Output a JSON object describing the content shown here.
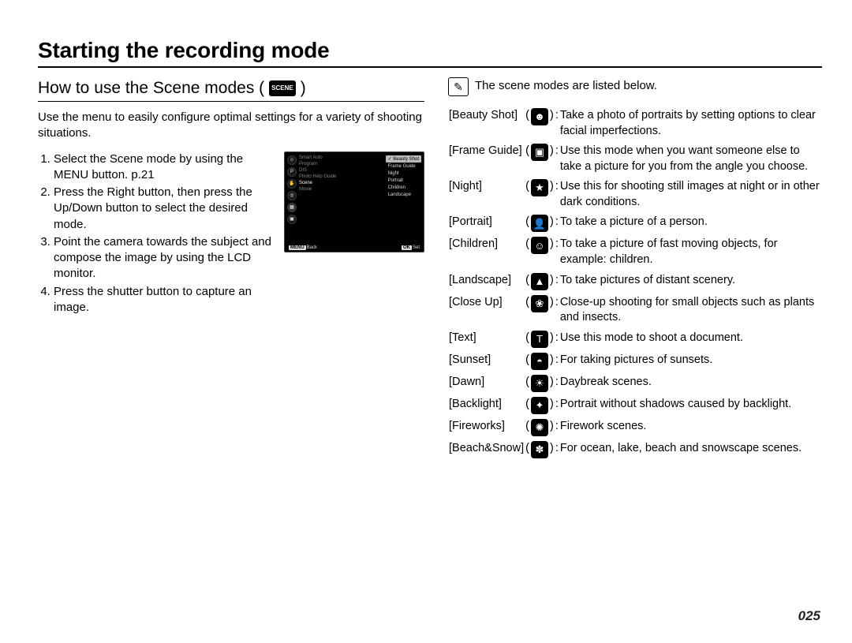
{
  "title": "Starting the recording mode",
  "left": {
    "subheading": "How to use the Scene modes (",
    "subheading_close": ")",
    "scene_tag": "SCENE",
    "intro": "Use the menu to easily configure optimal settings for a variety of shooting situations.",
    "steps": [
      "Select the Scene mode by using the MENU button. p.21",
      "Press the Right button, then press the Up/Down button to select the desired mode.",
      "Point the camera towards the subject and compose the image by using the LCD monitor.",
      "Press the shutter button to capture an image."
    ],
    "lcd": {
      "left_labels": [
        "Smart Auto",
        "Program",
        "DIS",
        "Photo Help Guide",
        "Scene",
        "Movie"
      ],
      "menu": [
        "Beauty Shot",
        "Frame Guide",
        "Night",
        "Portrait",
        "Children",
        "Landscape"
      ],
      "selected": 0,
      "foot_left": "Back",
      "foot_left_btn": "MENU",
      "foot_right": "Set",
      "foot_right_btn": "OK"
    }
  },
  "right": {
    "note": "The scene modes are listed below.",
    "rows": [
      {
        "name": "[Beauty Shot]",
        "icon": "beauty-shot-icon",
        "glyph": "☻",
        "desc": "Take a photo of portraits by setting options to clear facial imperfections."
      },
      {
        "name": "[Frame Guide]",
        "icon": "frame-guide-icon",
        "glyph": "▣",
        "desc": "Use this mode when you want someone else to take a picture for you from the angle you choose."
      },
      {
        "name": "[Night]",
        "icon": "night-icon",
        "glyph": "★",
        "desc": "Use this for shooting still images at night or in other dark conditions."
      },
      {
        "name": "[Portrait]",
        "icon": "portrait-icon",
        "glyph": "👤",
        "desc": "To take a picture of a person."
      },
      {
        "name": "[Children]",
        "icon": "children-icon",
        "glyph": "☺",
        "desc": "To take a picture of fast moving objects, for example: children."
      },
      {
        "name": "[Landscape]",
        "icon": "landscape-icon",
        "glyph": "▲",
        "desc": "To take pictures of distant scenery."
      },
      {
        "name": "[Close Up]",
        "icon": "close-up-icon",
        "glyph": "❀",
        "desc": "Close-up shooting for small objects such as plants and insects."
      },
      {
        "name": "[Text]",
        "icon": "text-icon",
        "glyph": "T",
        "desc": "Use this mode to shoot a document."
      },
      {
        "name": "[Sunset]",
        "icon": "sunset-icon",
        "glyph": "◓",
        "desc": "For taking pictures of sunsets."
      },
      {
        "name": "[Dawn]",
        "icon": "dawn-icon",
        "glyph": "☀",
        "desc": "Daybreak scenes."
      },
      {
        "name": "[Backlight]",
        "icon": "backlight-icon",
        "glyph": "✦",
        "desc": "Portrait without shadows caused by backlight."
      },
      {
        "name": "[Fireworks]",
        "icon": "fireworks-icon",
        "glyph": "✺",
        "desc": "Firework scenes."
      },
      {
        "name": "[Beach&Snow]",
        "icon": "beach-snow-icon",
        "glyph": "✽",
        "desc": "For ocean, lake, beach and snowscape scenes."
      }
    ]
  },
  "page_number": "025"
}
